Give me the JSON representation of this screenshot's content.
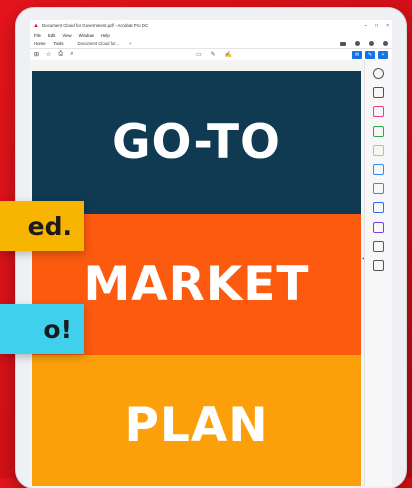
{
  "window": {
    "title": "Document Cloud for Government.pdf - Acrobat Pro DC",
    "controls": [
      "–",
      "□",
      "×"
    ]
  },
  "menu": [
    "File",
    "Edit",
    "View",
    "Window",
    "Help"
  ],
  "tabs": {
    "home": "Home",
    "tools": "Tools",
    "document": "Document Cloud for...",
    "close": "×"
  },
  "document": {
    "bands": [
      {
        "text": "GO-TO",
        "color": "#0f3a52"
      },
      {
        "text": "MARKET",
        "color": "#fb5a0f"
      },
      {
        "text": "PLAN",
        "color": "#fba00b"
      }
    ]
  },
  "callouts": {
    "first": "ed.",
    "second": "o!"
  },
  "right_panel_icons": [
    {
      "name": "zoom-icon",
      "color": "#555555"
    },
    {
      "name": "export-pdf-icon",
      "color": "#e5141b"
    },
    {
      "name": "edit-pdf-icon",
      "color": "#ec3a8b"
    },
    {
      "name": "create-pdf-icon",
      "color": "#2aa84a"
    },
    {
      "name": "comment-icon",
      "color": "#f2c200"
    },
    {
      "name": "organize-pages-icon",
      "color": "#2a8ff2"
    },
    {
      "name": "scan-icon",
      "color": "#2a8ff2"
    },
    {
      "name": "protect-icon",
      "color": "#2a6ff2"
    },
    {
      "name": "fill-sign-icon",
      "color": "#7b3fe4"
    },
    {
      "name": "request-signature-icon",
      "color": "#8e2fb5"
    },
    {
      "name": "more-tools-icon",
      "color": "#555555"
    }
  ]
}
